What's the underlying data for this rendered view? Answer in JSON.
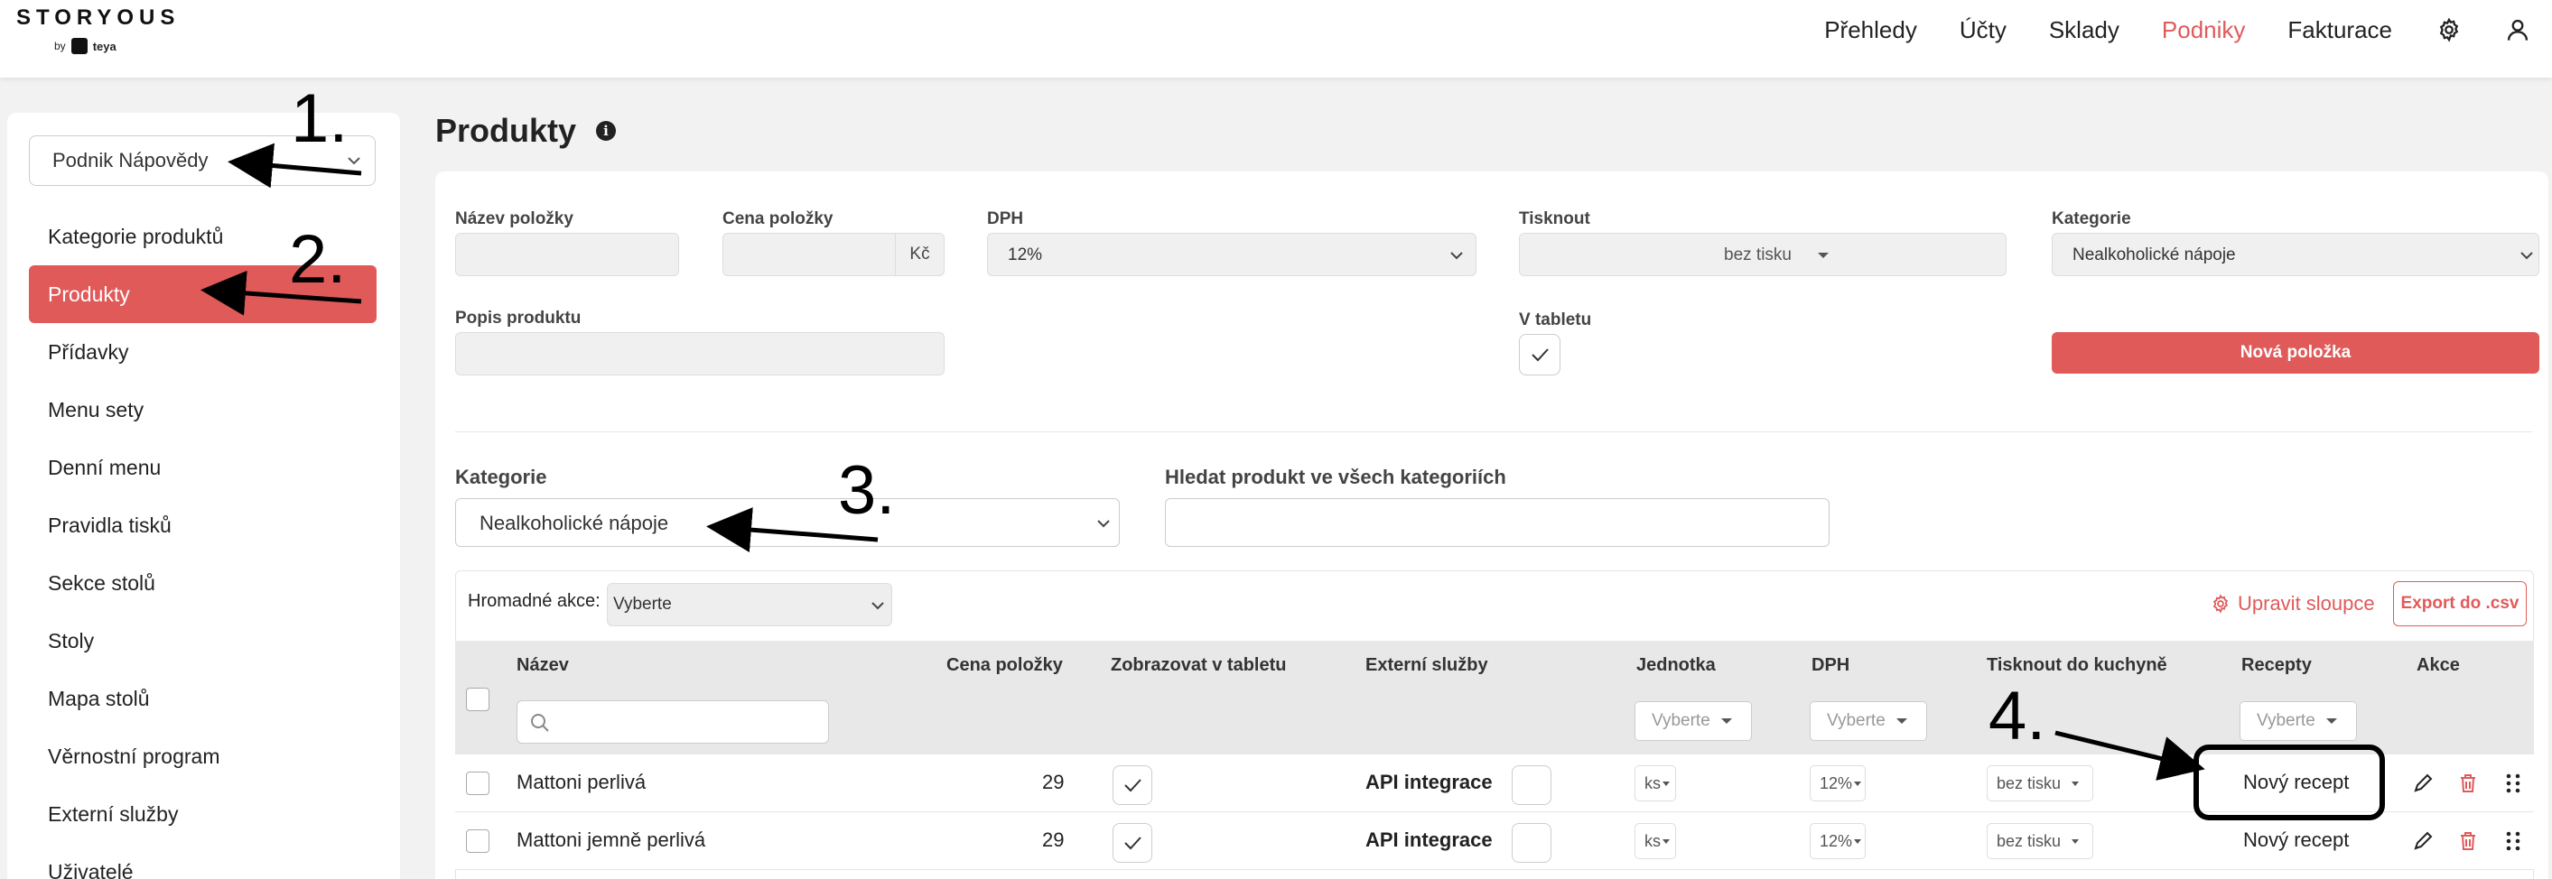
{
  "brand": {
    "name": "STORYOUS",
    "by": "by",
    "partner": "teya"
  },
  "nav": {
    "items": [
      "Přehledy",
      "Účty",
      "Sklady",
      "Podniky",
      "Fakturace"
    ],
    "active": "Podniky",
    "icons": [
      "gear-icon",
      "user-icon"
    ]
  },
  "sidebar": {
    "venue": "Podnik Nápovědy",
    "items": [
      "Kategorie produktů",
      "Produkty",
      "Přídavky",
      "Menu sety",
      "Denní menu",
      "Pravidla tisků",
      "Sekce stolů",
      "Stoly",
      "Mapa stolů",
      "Věrnostní program",
      "Externí služby",
      "Uživatelé"
    ],
    "active": "Produkty"
  },
  "page": {
    "title": "Produkty"
  },
  "form": {
    "name_label": "Název položky",
    "price_label": "Cena položky",
    "currency": "Kč",
    "vat_label": "DPH",
    "vat_value": "12%",
    "print_label": "Tisknout",
    "print_value": "bez tisku",
    "category_label": "Kategorie",
    "category_value": "Nealkoholické nápoje",
    "desc_label": "Popis produktu",
    "tablet_label": "V tabletu",
    "tablet_checked": true,
    "new_item_button": "Nová položka"
  },
  "filter": {
    "category_label": "Kategorie",
    "category_value": "Nealkoholické nápoje",
    "search_label": "Hledat produkt ve všech kategoriích"
  },
  "bulk": {
    "label": "Hromadné akce:",
    "value": "Vyberte",
    "edit_columns": "Upravit sloupce",
    "export": "Export do .csv"
  },
  "table": {
    "headers": [
      "Název",
      "Cena položky",
      "Zobrazovat v tabletu",
      "Externí služby",
      "Jednotka",
      "DPH",
      "Tisknout do kuchyně",
      "Recepty",
      "Akce"
    ],
    "filter_placeholder": "Vyberte",
    "rows": [
      {
        "name": "Mattoni perlivá",
        "price": "29",
        "tablet": true,
        "external": "API integrace",
        "unit": "ks",
        "vat": "12%",
        "print": "bez tisku",
        "recipe": "Nový recept"
      },
      {
        "name": "Mattoni jemně perlivá",
        "price": "29",
        "tablet": true,
        "external": "API integrace",
        "unit": "ks",
        "vat": "12%",
        "print": "bez tisku",
        "recipe": "Nový recept"
      }
    ]
  },
  "annotations": [
    "1.",
    "2.",
    "3.",
    "4."
  ],
  "colors": {
    "accent": "#e05a5a"
  }
}
